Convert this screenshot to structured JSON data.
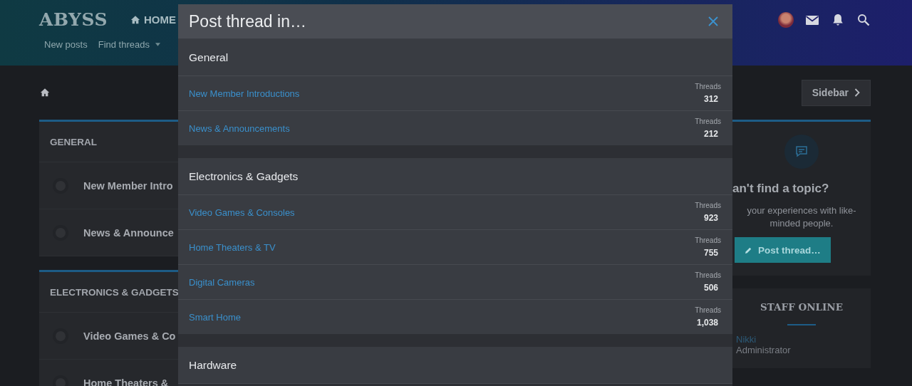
{
  "header": {
    "logo": "ABYSS",
    "nav": [
      {
        "label": "HOME",
        "selected": true
      }
    ],
    "subnav": [
      {
        "label": "New posts",
        "has_menu": false
      },
      {
        "label": "Find threads",
        "has_menu": true
      }
    ]
  },
  "sidebar_button": "Sidebar",
  "forum_list": [
    {
      "title": "GENERAL",
      "nodes": [
        "New Member Intro",
        "News & Announce"
      ]
    },
    {
      "title": "ELECTRONICS & GADGETS",
      "nodes": [
        "Video Games & Co",
        "Home Theaters &"
      ]
    }
  ],
  "cta": {
    "title": "an't find a topic?",
    "text": "your experiences with like-minded people.",
    "button": "Post thread…"
  },
  "staff": {
    "title": "STAFF ONLINE",
    "members": [
      {
        "name": "Nikki",
        "role": "Administrator"
      }
    ]
  },
  "modal": {
    "title": "Post thread in…",
    "sections": [
      {
        "title": "General",
        "forums": [
          {
            "name": "New Member Introductions",
            "stat_label": "Threads",
            "count": "312"
          },
          {
            "name": "News & Announcements",
            "stat_label": "Threads",
            "count": "212"
          }
        ]
      },
      {
        "title": "Electronics & Gadgets",
        "forums": [
          {
            "name": "Video Games & Consoles",
            "stat_label": "Threads",
            "count": "923"
          },
          {
            "name": "Home Theaters & TV",
            "stat_label": "Threads",
            "count": "755"
          },
          {
            "name": "Digital Cameras",
            "stat_label": "Threads",
            "count": "506"
          },
          {
            "name": "Smart Home",
            "stat_label": "Threads",
            "count": "1,038"
          }
        ]
      },
      {
        "title": "Hardware"
      }
    ]
  }
}
